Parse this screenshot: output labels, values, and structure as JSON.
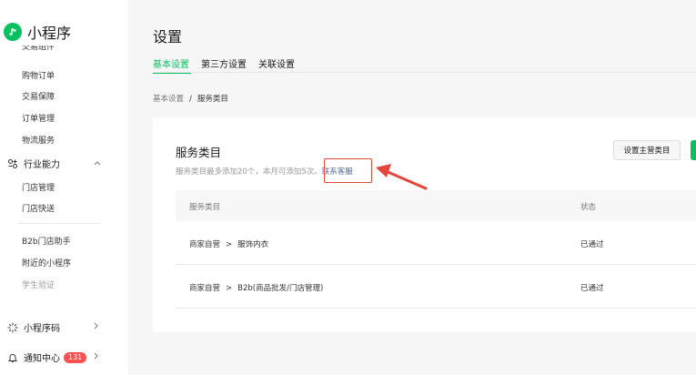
{
  "app": {
    "name": "小程序",
    "accent": "#07c160"
  },
  "sidebar": {
    "cut_item": "交易组件",
    "items": [
      {
        "label": "购物订单"
      },
      {
        "label": "交易保障"
      },
      {
        "label": "订单管理"
      },
      {
        "label": "物流服务"
      }
    ],
    "group_industry": {
      "label": "行业能力",
      "icon": "industry-icon"
    },
    "industry_items": [
      {
        "label": "门店管理"
      },
      {
        "label": "门店快送"
      }
    ],
    "extra_items": [
      {
        "label": "B2b门店助手"
      },
      {
        "label": "附近的小程序"
      },
      {
        "label": "学生验证"
      }
    ],
    "group_code": {
      "label": "小程序码",
      "icon": "qrcode-icon"
    },
    "group_notify": {
      "label": "通知中心",
      "badge": "131",
      "icon": "bell-icon"
    }
  },
  "page": {
    "title": "设置"
  },
  "tabs": [
    {
      "label": "基本设置",
      "active": true
    },
    {
      "label": "第三方设置",
      "active": false
    },
    {
      "label": "关联设置",
      "active": false
    }
  ],
  "breadcrumb": {
    "parent": "基本设置",
    "separator": "/",
    "current": "服务类目"
  },
  "card": {
    "title": "服务类目",
    "desc": "服务类目最多添加20个，本月可添加5次。",
    "link": "联系客服",
    "button_secondary": "设置主营类目"
  },
  "table": {
    "columns": [
      "服务类目",
      "状态"
    ],
    "rows": [
      {
        "category": "商家自营",
        "sub": "服饰内衣",
        "status": "已通过"
      },
      {
        "category": "商家自营",
        "sub": "B2b(商品批发/门店管理)",
        "status": "已通过"
      }
    ],
    "path_sep": ">"
  }
}
